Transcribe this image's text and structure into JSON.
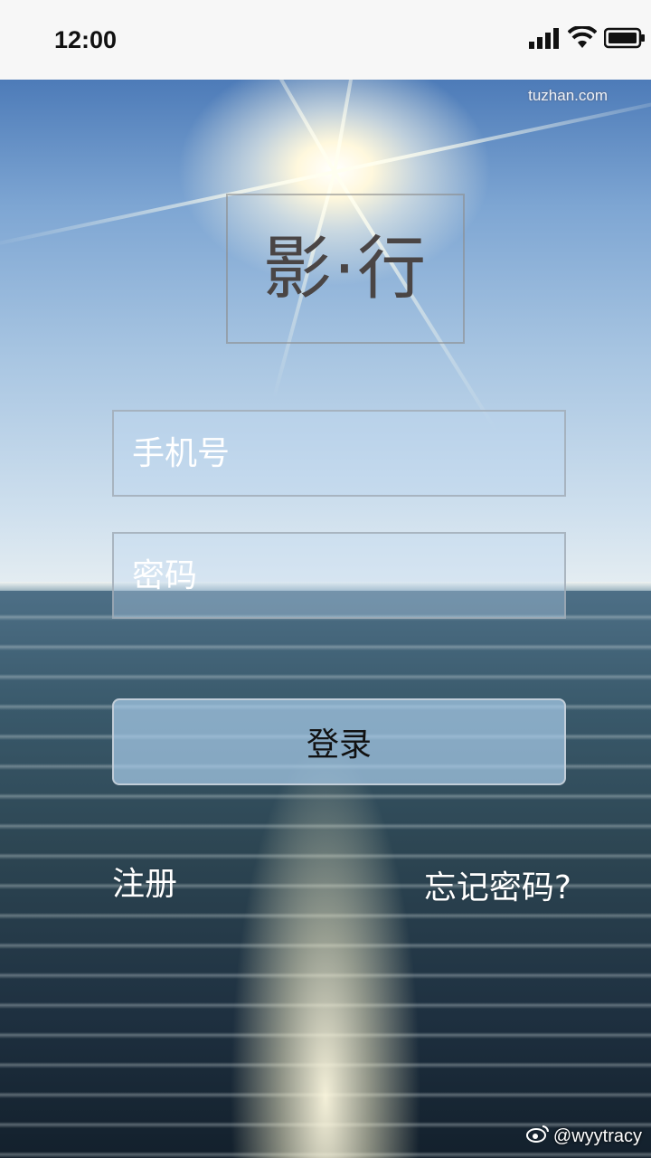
{
  "status_bar": {
    "time": "12:00"
  },
  "watermarks": {
    "top": "tuzhan.com",
    "bottom": "@wyytracy"
  },
  "logo": {
    "text": "影·行"
  },
  "form": {
    "phone_placeholder": "手机号",
    "password_placeholder": "密码",
    "login_label": "登录"
  },
  "links": {
    "register": "注册",
    "forgot_password": "忘记密码?"
  },
  "colors": {
    "status_bar_bg": "#f7f7f7",
    "logo_text": "#4a4545",
    "button_bg": "#aacdeb"
  },
  "icons": [
    "signal-icon",
    "wifi-icon",
    "battery-icon",
    "weibo-icon"
  ]
}
